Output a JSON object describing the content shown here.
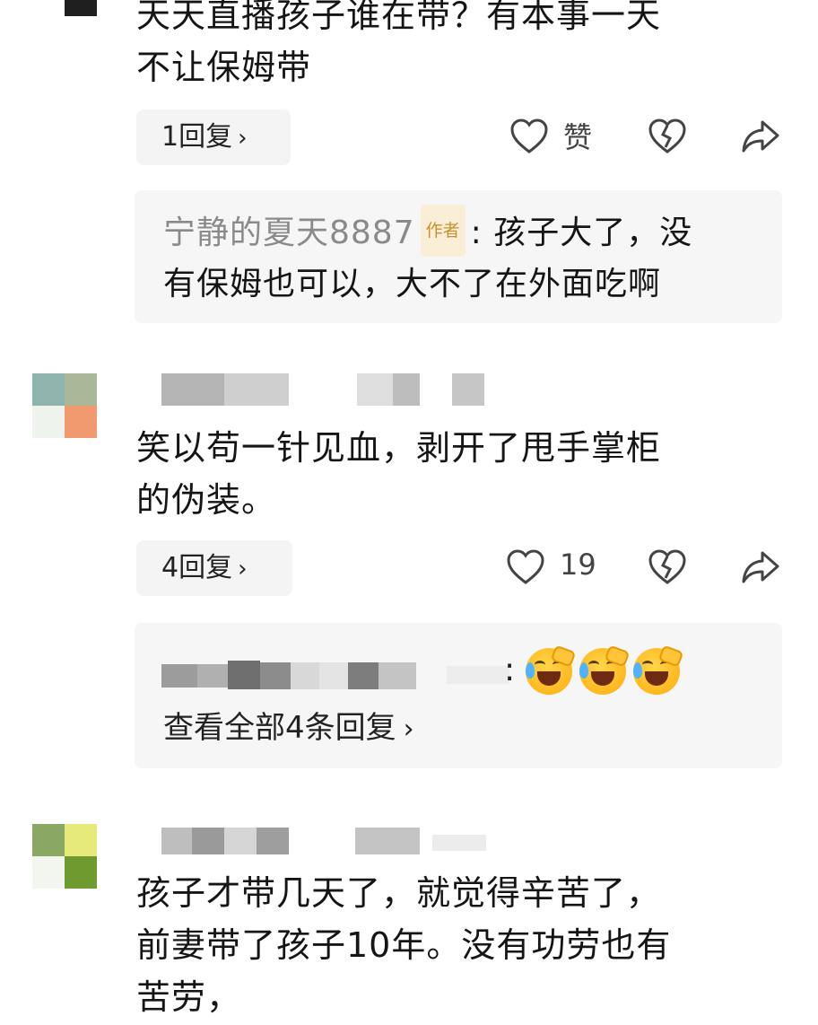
{
  "comments": [
    {
      "text_lines": [
        "天天直播孩子谁在带？有本事一天",
        "不让保姆带"
      ],
      "reply_button": "1回复",
      "like_label": "赞",
      "sub_reply": {
        "author": "宁静的夏天8887",
        "badge": "作者",
        "colon": ":",
        "text_line1": "孩子大了，没",
        "text_line2": "有保姆也可以，大不了在外面吃啊"
      }
    },
    {
      "text_lines": [
        "笑以苟一针见血，剥开了甩手掌柜",
        "的伪装。"
      ],
      "reply_button": "4回复",
      "like_label": "19",
      "sub_reply": {
        "colon": ":",
        "emojis": [
          "rofl-emoji",
          "rofl-emoji",
          "rofl-emoji"
        ],
        "view_all": "查看全部4条回复"
      }
    },
    {
      "text_lines": [
        "孩子才带几天了，就觉得辛苦了，",
        "前妻带了孩子10年。没有功劳也有",
        "苦劳，"
      ]
    }
  ],
  "icons": {
    "like": "heart-outline-icon",
    "dislike": "broken-heart-icon",
    "share": "share-arrow-icon",
    "chevron": "chevron-right-icon"
  },
  "colors": {
    "pill_bg": "#f4f4f4",
    "sub_box_bg": "#f6f6f6",
    "author_name": "#8a8a8a",
    "badge_text": "#c8902f",
    "badge_bg": "#fbeed6"
  }
}
